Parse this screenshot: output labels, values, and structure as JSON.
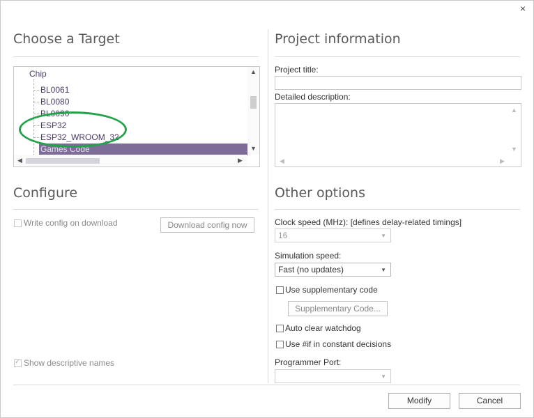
{
  "window": {
    "close_glyph": "×"
  },
  "target": {
    "title": "Choose a Target",
    "tree": {
      "root": "Chip",
      "items": [
        "BL0061",
        "BL0080",
        "BL0090",
        "ESP32",
        "ESP32_WROOM_32",
        "Games Code"
      ],
      "selected_index": 5
    }
  },
  "project": {
    "title": "Project information",
    "title_label": "Project title:",
    "title_value": "",
    "description_label": "Detailed description:",
    "description_value": ""
  },
  "configure": {
    "title": "Configure",
    "write_config_label": "Write config on download",
    "download_button": "Download config now",
    "descriptive_names_label": "Show descriptive names",
    "descriptive_names_checked": true
  },
  "options": {
    "title": "Other options",
    "clock_label": "Clock speed (MHz): [defines delay-related timings]",
    "clock_value": "16",
    "sim_label": "Simulation speed:",
    "sim_value": "Fast (no updates)",
    "supp_label": "Use supplementary code",
    "supp_button": "Supplementary Code...",
    "watchdog_label": "Auto clear watchdog",
    "constdec_label": "Use #if in constant decisions",
    "port_label": "Programmer Port:",
    "port_value": ""
  },
  "footer": {
    "modify": "Modify",
    "cancel": "Cancel"
  },
  "colors": {
    "selection": "#7d6b98",
    "annotation": "#22a34a",
    "tree_text": "#4b3a66"
  }
}
